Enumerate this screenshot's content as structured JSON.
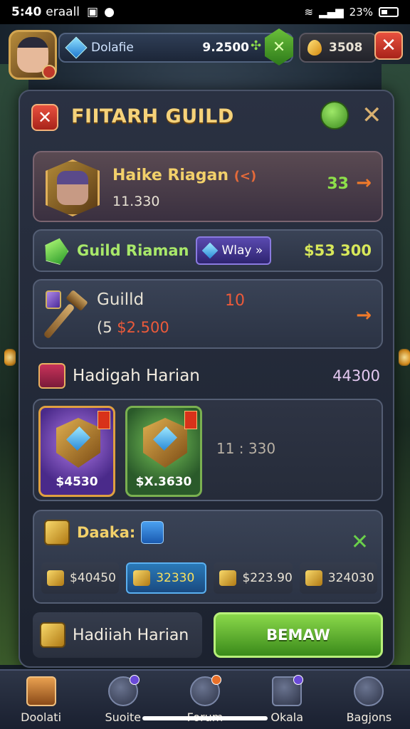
{
  "status_bar": {
    "time": "5:40",
    "carrier": "eraall",
    "battery": "23%"
  },
  "hud": {
    "bar_label": "Dolafie",
    "bar_value": "9.2500",
    "coin_value": "3508",
    "close_label": "✕"
  },
  "panel": {
    "title": "FIITARH GUILD",
    "close_label": "✕",
    "x_label": "✕"
  },
  "profile": {
    "name": "Haike Riagan",
    "tag": "(<)",
    "subtitle": "11.330",
    "number": "33",
    "arrow": "→"
  },
  "guild_bar": {
    "label": "Guild Riaman",
    "chip": "Wlay »",
    "value": "$53 300"
  },
  "weapon": {
    "title": "Guilld",
    "sub_prefix": "(5",
    "sub_value": "$2.500",
    "number": "10",
    "arrow": "→"
  },
  "daily": {
    "label": "Hadigah Harian",
    "value": "44300"
  },
  "rewards": {
    "tiles": [
      {
        "price": "$4530"
      },
      {
        "price": "$X.3630"
      }
    ],
    "timer": "11 : 330"
  },
  "shop": {
    "label": "Daaka:",
    "x": "✕",
    "items": [
      {
        "value": "$40450"
      },
      {
        "value": "32330"
      },
      {
        "value": "$223.90"
      },
      {
        "value": "324030"
      }
    ]
  },
  "claim": {
    "label": "Hadiiah Harian",
    "button": "BEMAW"
  },
  "nav": {
    "items": [
      {
        "label": "Doolati"
      },
      {
        "label": "Suoite"
      },
      {
        "label": "Forum"
      },
      {
        "label": "Okala"
      },
      {
        "label": "Bagjons"
      }
    ]
  },
  "colors": {
    "title_gold": "#f5d27a",
    "accent_green": "#8ee04a",
    "accent_red": "#ec5a3a",
    "claim_green": "#5ab02a"
  },
  "icons": [
    "avatar",
    "blue-gem-icon",
    "green-hex-icon",
    "gold-gem-icon",
    "close-icon",
    "lock-icon",
    "green-gem-icon",
    "shield-icon",
    "hammer-icon",
    "chest-icon",
    "gold-box-icon",
    "home-icon",
    "compass-icon",
    "search-icon",
    "scroll-icon",
    "profile-icon"
  ]
}
